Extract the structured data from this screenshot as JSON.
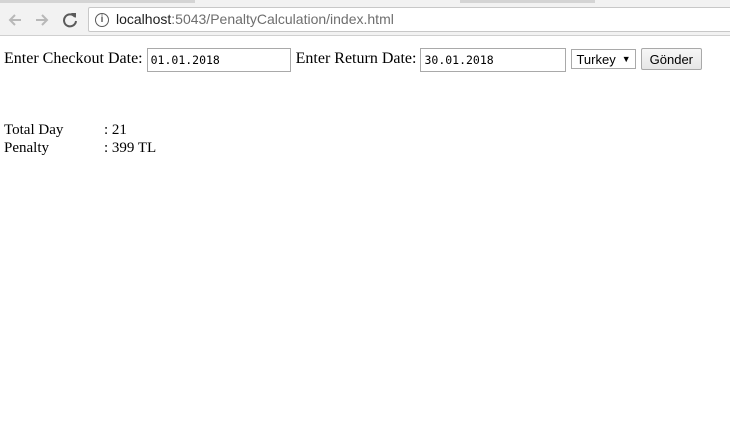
{
  "browser": {
    "url_host": "localhost",
    "url_rest": ":5043/PenaltyCalculation/index.html"
  },
  "form": {
    "checkout_label": "Enter Checkout Date:",
    "checkout_value": "01.01.2018",
    "return_label": "Enter Return Date:",
    "return_value": "30.01.2018",
    "country_selected": "Turkey",
    "submit_label": "Gönder"
  },
  "results": {
    "total_day_label": "Total Day",
    "total_day_value": ": 21",
    "penalty_label": "Penalty",
    "penalty_value": ": 399 TL"
  }
}
